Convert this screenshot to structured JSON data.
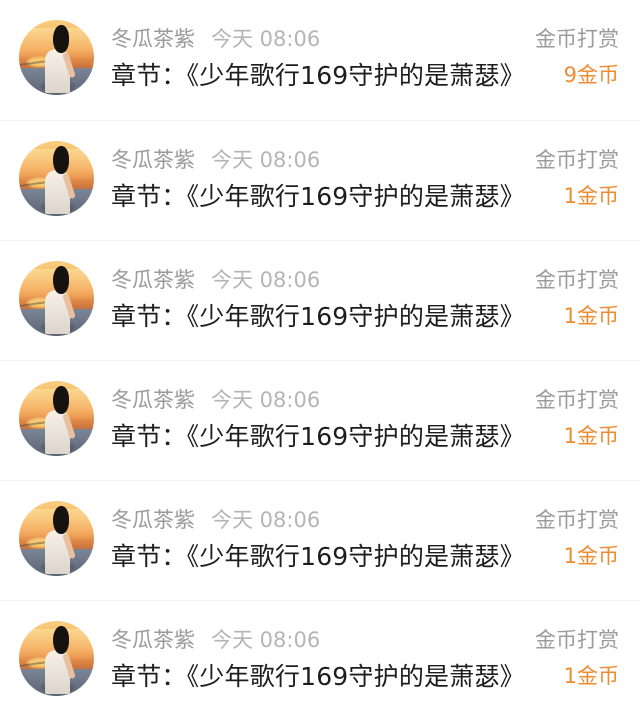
{
  "records": [
    {
      "avatar_icon": "user-avatar-photo",
      "username": "冬瓜茶紫",
      "timestamp": "今天 08:06",
      "type_label": "金币打赏",
      "chapter_title": "章节：《少年歌行169守护的是萧瑟》",
      "coin_amount": "9金币"
    },
    {
      "avatar_icon": "user-avatar-photo",
      "username": "冬瓜茶紫",
      "timestamp": "今天 08:06",
      "type_label": "金币打赏",
      "chapter_title": "章节：《少年歌行169守护的是萧瑟》",
      "coin_amount": "1金币"
    },
    {
      "avatar_icon": "user-avatar-photo",
      "username": "冬瓜茶紫",
      "timestamp": "今天 08:06",
      "type_label": "金币打赏",
      "chapter_title": "章节：《少年歌行169守护的是萧瑟》",
      "coin_amount": "1金币"
    },
    {
      "avatar_icon": "user-avatar-photo",
      "username": "冬瓜茶紫",
      "timestamp": "今天 08:06",
      "type_label": "金币打赏",
      "chapter_title": "章节：《少年歌行169守护的是萧瑟》",
      "coin_amount": "1金币"
    },
    {
      "avatar_icon": "user-avatar-photo",
      "username": "冬瓜茶紫",
      "timestamp": "今天 08:06",
      "type_label": "金币打赏",
      "chapter_title": "章节：《少年歌行169守护的是萧瑟》",
      "coin_amount": "1金币"
    },
    {
      "avatar_icon": "user-avatar-photo",
      "username": "冬瓜茶紫",
      "timestamp": "今天 08:06",
      "type_label": "金币打赏",
      "chapter_title": "章节：《少年歌行169守护的是萧瑟》",
      "coin_amount": "1金币"
    }
  ],
  "colors": {
    "page_background": "#ffffff",
    "primary_text": "#1d1d1d",
    "secondary_text": "#9a9a9a",
    "timestamp_text": "#b5b5b5",
    "coin_text": "#ef8b31",
    "separator": "#f3f3f3"
  }
}
